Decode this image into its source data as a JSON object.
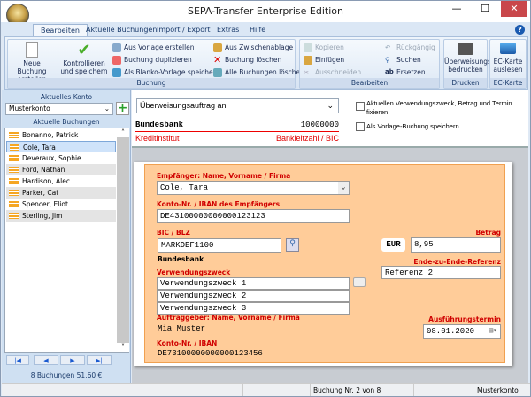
{
  "window": {
    "title": "SEPA-Transfer  Enterprise Edition",
    "min": "—",
    "max": "☐",
    "close": "✕"
  },
  "tabs": [
    {
      "label": "Bearbeiten",
      "active": true
    },
    {
      "label": "Aktuelle Buchungen"
    },
    {
      "label": "Import / Export"
    },
    {
      "label": "Extras"
    },
    {
      "label": "Hilfe"
    }
  ],
  "help": "?",
  "ribbon": {
    "buchung": {
      "label": "Buchung",
      "new": "Neue Buchung erstellen",
      "check": "Kontrollieren und speichern",
      "from_template": "Aus Vorlage erstellen",
      "duplicate": "Buchung duplizieren",
      "blank_template": "Als Blanko-Vorlage speichern",
      "from_clipboard": "Aus Zwischenablage",
      "delete": "Buchung löschen",
      "delete_all": "Alle Buchungen löschen"
    },
    "bearbeiten": {
      "label": "Bearbeiten",
      "copy": "Kopieren",
      "paste": "Einfügen",
      "cut": "Ausschneiden",
      "undo": "Rückgängig",
      "search": "Suchen",
      "replace": "Ersetzen"
    },
    "drucken": {
      "label": "Drucken",
      "print": "Überweisungsträger bedrucken"
    },
    "eckarte": {
      "label": "EC-Karte",
      "read": "EC-Karte auslesen"
    }
  },
  "sidebar": {
    "account_header": "Aktuelles Konto",
    "account": "Musterkonto",
    "add": "+",
    "bookings_header": "Aktuelle Buchungen",
    "items": [
      "Bonanno, Patrick",
      "Cole, Tara",
      "Deveraux, Sophie",
      "Ford, Nathan",
      "Hardison, Alec",
      "Parker, Cat",
      "Spencer, Eliot",
      "Sterling, Jim"
    ],
    "selected_index": 1,
    "nav": [
      "|◀",
      "◀",
      "▶",
      "▶|"
    ],
    "summary": "8 Buchungen 51,60 €"
  },
  "top": {
    "order_type": "Überweisungsauftrag an",
    "bank": "Bundesbank",
    "blz": "10000000",
    "bank_label": "Kreditinstitut",
    "blz_label": "Bankleitzahl / BIC",
    "fix_option": "Aktuellen Verwendungszweck, Betrag und Termin fixieren",
    "template_option": "Als Vorlage-Buchung speichern"
  },
  "form": {
    "recipient_label": "Empfänger: Name, Vorname / Firma",
    "recipient": "Cole, Tara",
    "iban_label": "Konto-Nr. / IBAN des Empfängers",
    "iban": "DE43100000000000123123",
    "bic_label": "BIC / BLZ",
    "bic": "MARKDEF1100",
    "bank_name": "Bundesbank",
    "purpose_label": "Verwendungszweck",
    "purpose": [
      "Verwendungszweck 1",
      "Verwendungszweck 2",
      "Verwendungszweck 3"
    ],
    "sender_label": "Auftraggeber: Name, Vorname / Firma",
    "sender": "Mia Muster",
    "sender_iban_label": "Konto-Nr. / IBAN",
    "sender_iban": "DE73100000000000123456",
    "amount_label": "Betrag",
    "currency": "EUR",
    "amount": "8,95",
    "reference_label": "Ende-zu-Ende-Referenz",
    "reference": "Referenz 2",
    "date_label": "Ausführungstermin",
    "date": "08.01.2020"
  },
  "status": {
    "record": "Buchung Nr. 2 von 8",
    "account": "Musterkonto"
  }
}
